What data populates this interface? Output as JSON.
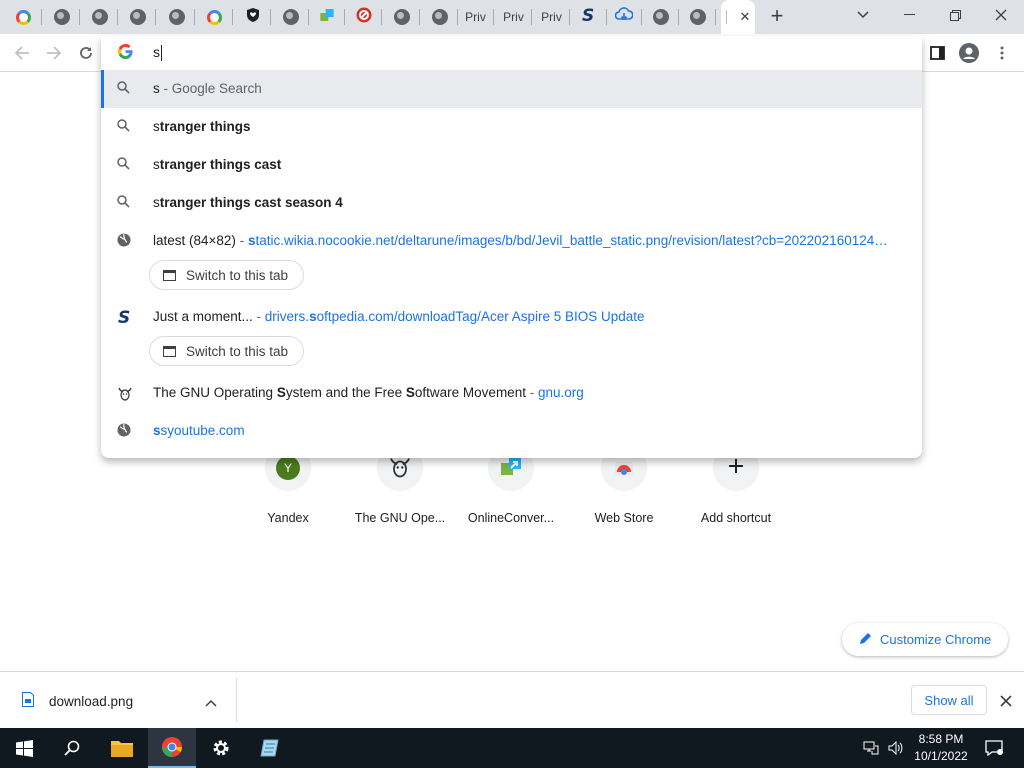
{
  "tabs": [
    {
      "icon": "google-icon",
      "label": ""
    },
    {
      "icon": "globe-icon",
      "label": ""
    },
    {
      "icon": "globe-icon",
      "label": ""
    },
    {
      "icon": "globe-icon",
      "label": ""
    },
    {
      "icon": "globe-icon",
      "label": ""
    },
    {
      "icon": "google-icon",
      "label": ""
    },
    {
      "icon": "shield-heart-icon",
      "label": ""
    },
    {
      "icon": "globe-icon",
      "label": ""
    },
    {
      "icon": "online-convert-icon",
      "label": ""
    },
    {
      "icon": "red-circle-icon",
      "label": ""
    },
    {
      "icon": "globe-icon",
      "label": ""
    },
    {
      "icon": "globe-icon",
      "label": ""
    },
    {
      "icon": "text",
      "label": "Priv"
    },
    {
      "icon": "text",
      "label": "Priv"
    },
    {
      "icon": "text",
      "label": "Priv"
    },
    {
      "icon": "softpedia-icon",
      "label": ""
    },
    {
      "icon": "cloud-download-icon",
      "label": ""
    },
    {
      "icon": "globe-icon",
      "label": ""
    },
    {
      "icon": "globe-icon",
      "label": ""
    }
  ],
  "active_tab": {
    "label": "",
    "close": "✕"
  },
  "new_tab_label": "+",
  "omnibox": {
    "typed": "s",
    "suggestions": [
      {
        "type": "search",
        "prefix": "s",
        "bold": "",
        "suffix": " - Google Search",
        "selected": true
      },
      {
        "type": "search",
        "prefix": "s",
        "bold": "tranger things",
        "suffix": ""
      },
      {
        "type": "search",
        "prefix": "s",
        "bold": "tranger things cast",
        "suffix": ""
      },
      {
        "type": "search",
        "prefix": "s",
        "bold": "tranger things cast season 4",
        "suffix": ""
      }
    ],
    "tab_match_1": {
      "title": "latest (84×82)",
      "dash": " - ",
      "url_bold": "s",
      "url_rest": "tatic.wikia.nocookie.net/deltarune/images/b/bd/Jevil_battle_static.png/revision/latest?cb=202202160124…"
    },
    "switch_label": "Switch to this tab",
    "tab_match_2": {
      "title": "Just a moment...",
      "dash": " - ",
      "url_pre": "drivers.",
      "url_bold": "s",
      "url_rest": "oftpedia.com/downloadTag/Acer Aspire 5 BIOS Update"
    },
    "history_1": {
      "pre": "The GNU Operating ",
      "b1": "S",
      "mid": "ystem and the Free ",
      "b2": "S",
      "post": "oftware Movement",
      "dash": " - ",
      "url": "gnu.org"
    },
    "history_2": {
      "url_bold": "s",
      "url_rest": "syoutube.com"
    }
  },
  "shortcuts": [
    {
      "label": "Yandex",
      "icon": "yandex-icon",
      "letter": "Y"
    },
    {
      "label": "The GNU Ope...",
      "icon": "gnu-icon"
    },
    {
      "label": "OnlineConver...",
      "icon": "online-convert-icon"
    },
    {
      "label": "Web Store",
      "icon": "web-store-icon"
    },
    {
      "label": "Add shortcut",
      "icon": "plus-icon"
    }
  ],
  "customize_label": "Customize Chrome",
  "download": {
    "filename": "download.png",
    "show_all": "Show all"
  },
  "clock": {
    "time": "8:58 PM",
    "date": "10/1/2022"
  },
  "colors": {
    "accent": "#1a73e8",
    "tabstrip": "#dee1e6",
    "taskbar": "#101820"
  }
}
